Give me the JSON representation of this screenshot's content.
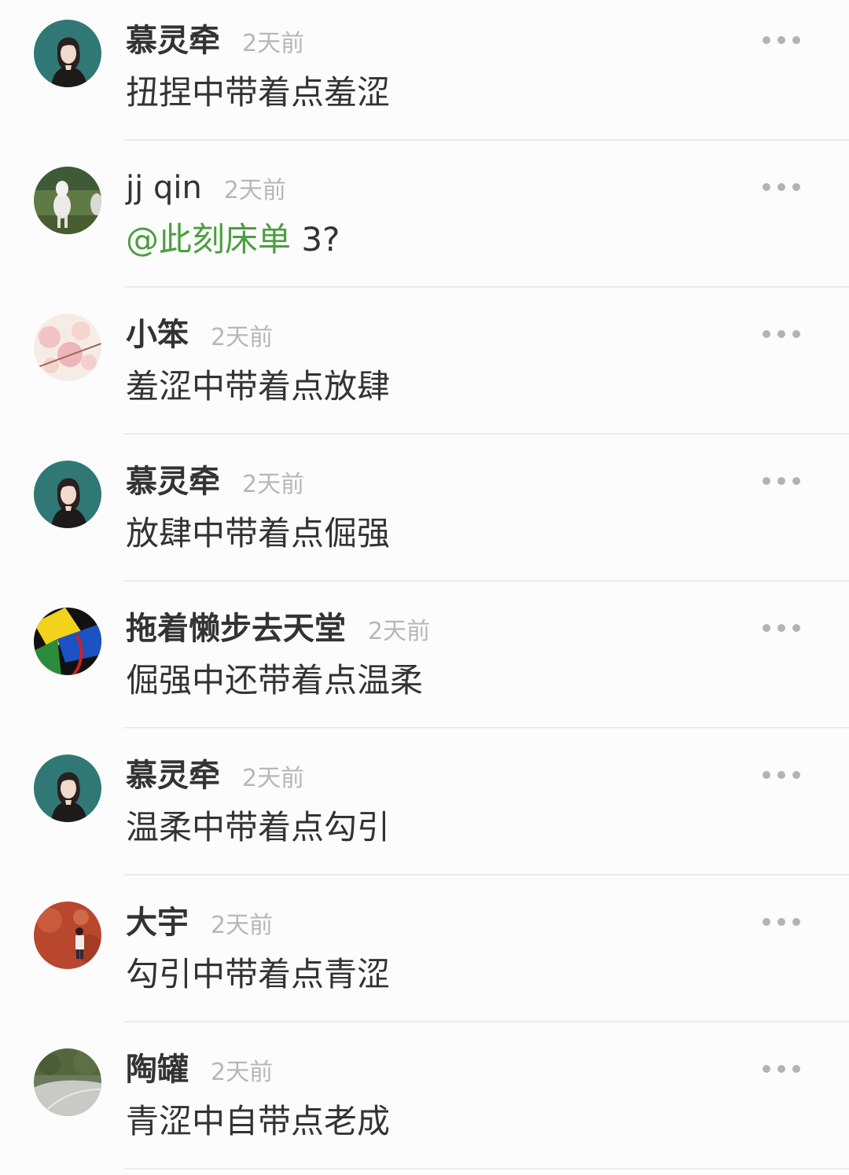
{
  "time_label": "2天前",
  "comments": [
    {
      "name": "慕灵牵",
      "content": "扭捏中带着点羞涩",
      "avatar": "girl-avatar"
    },
    {
      "name": "jj qin",
      "mention": "@此刻床单",
      "content": " 3?",
      "avatar": "goat-avatar"
    },
    {
      "name": "小笨",
      "content": "羞涩中带着点放肆",
      "avatar": "blossom-avatar"
    },
    {
      "name": "慕灵牵",
      "content": "放肆中带着点倔强",
      "avatar": "girl-avatar"
    },
    {
      "name": "拖着懒步去天堂",
      "content": "倔强中还带着点温柔",
      "avatar": "abstract-avatar"
    },
    {
      "name": "慕灵牵",
      "content": "温柔中带着点勾引",
      "avatar": "girl-avatar"
    },
    {
      "name": "大宇",
      "content": "勾引中带着点青涩",
      "avatar": "red-wall-avatar"
    },
    {
      "name": "陶罐",
      "content": "青涩中自带点老成",
      "avatar": "road-avatar"
    }
  ],
  "colors": {
    "name": "#333333",
    "time": "#b7b7b7",
    "mention": "#4a9f3f",
    "divider": "#ebebeb"
  },
  "icons": {
    "more": "more-dots-icon"
  }
}
